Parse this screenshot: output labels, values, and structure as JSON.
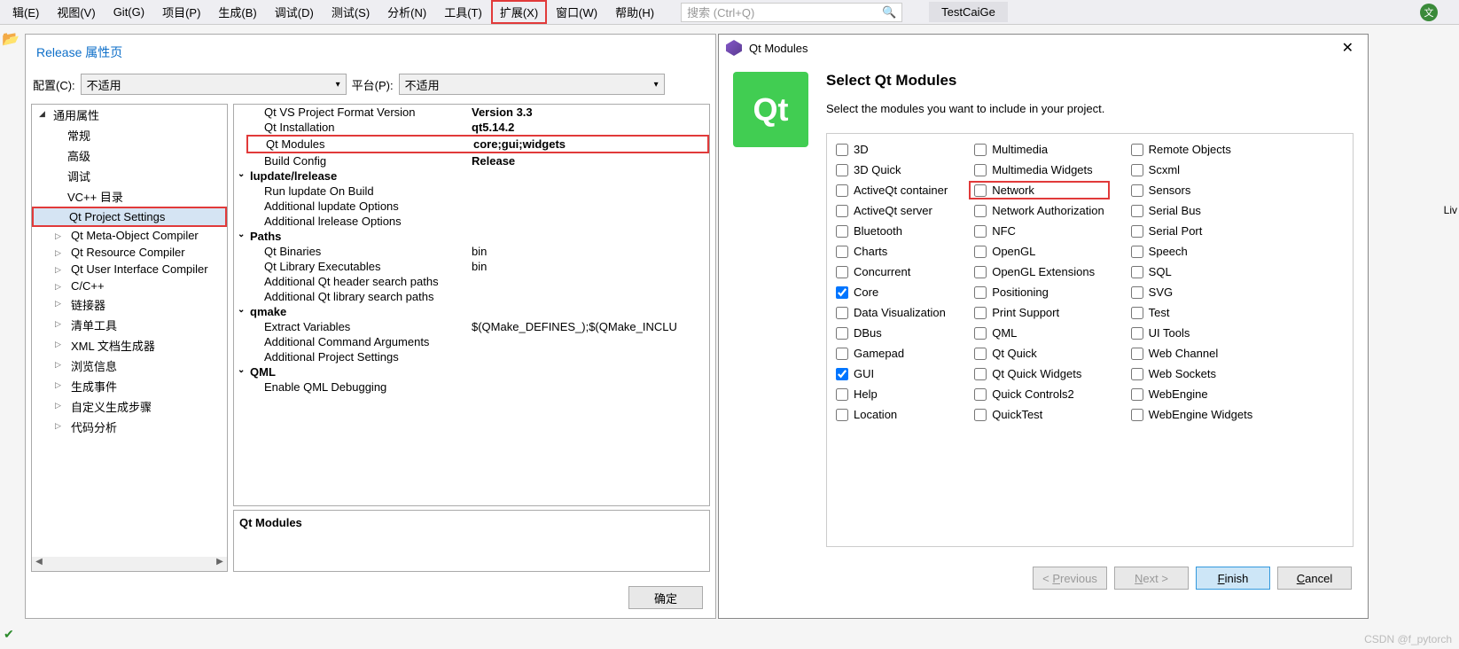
{
  "menubar": {
    "items": [
      "辑(E)",
      "视图(V)",
      "Git(G)",
      "项目(P)",
      "生成(B)",
      "调试(D)",
      "测试(S)",
      "分析(N)",
      "工具(T)",
      "扩展(X)",
      "窗口(W)",
      "帮助(H)"
    ],
    "highlighted_index": 9,
    "search_placeholder": "搜索 (Ctrl+Q)",
    "testcaige": "TestCaiGe",
    "user_initial": "文"
  },
  "prop_page": {
    "title": "Release 属性页",
    "config_label": "配置(C):",
    "config_value": "不适用",
    "platform_label": "平台(P):",
    "platform_value": "不适用",
    "tree": [
      {
        "label": "通用属性",
        "level": 1,
        "expanded": true
      },
      {
        "label": "常规",
        "level": 2
      },
      {
        "label": "高级",
        "level": 2
      },
      {
        "label": "调试",
        "level": 2
      },
      {
        "label": "VC++ 目录",
        "level": 2
      },
      {
        "label": "Qt Project Settings",
        "level": 2,
        "selected": true,
        "highlighted": true
      },
      {
        "label": "Qt Meta-Object Compiler",
        "level": 2,
        "expander": true
      },
      {
        "label": "Qt Resource Compiler",
        "level": 2,
        "expander": true
      },
      {
        "label": "Qt User Interface Compiler",
        "level": 2,
        "expander": true
      },
      {
        "label": "C/C++",
        "level": 2,
        "expander": true
      },
      {
        "label": "链接器",
        "level": 2,
        "expander": true
      },
      {
        "label": "清单工具",
        "level": 2,
        "expander": true
      },
      {
        "label": "XML 文档生成器",
        "level": 2,
        "expander": true
      },
      {
        "label": "浏览信息",
        "level": 2,
        "expander": true
      },
      {
        "label": "生成事件",
        "level": 2,
        "expander": true
      },
      {
        "label": "自定义生成步骤",
        "level": 2,
        "expander": true
      },
      {
        "label": "代码分析",
        "level": 2,
        "expander": true
      }
    ],
    "grid": [
      {
        "type": "row",
        "label": "Qt VS Project Format Version",
        "value": "Version 3.3",
        "bold": true
      },
      {
        "type": "row",
        "label": "Qt Installation",
        "value": "qt5.14.2",
        "bold": true
      },
      {
        "type": "row",
        "label": "Qt Modules",
        "value": "core;gui;widgets",
        "bold": true,
        "highlighted": true
      },
      {
        "type": "row",
        "label": "Build Config",
        "value": "Release",
        "bold": true
      },
      {
        "type": "header",
        "label": "lupdate/lrelease"
      },
      {
        "type": "row",
        "label": "Run lupdate On Build",
        "value": ""
      },
      {
        "type": "row",
        "label": "Additional lupdate Options",
        "value": ""
      },
      {
        "type": "row",
        "label": "Additional lrelease Options",
        "value": ""
      },
      {
        "type": "header",
        "label": "Paths"
      },
      {
        "type": "row",
        "label": "Qt Binaries",
        "value": "bin"
      },
      {
        "type": "row",
        "label": "Qt Library Executables",
        "value": "bin"
      },
      {
        "type": "row",
        "label": "Additional Qt header search paths",
        "value": ""
      },
      {
        "type": "row",
        "label": "Additional Qt library search paths",
        "value": ""
      },
      {
        "type": "header",
        "label": "qmake"
      },
      {
        "type": "row",
        "label": "Extract Variables",
        "value": "$(QMake_DEFINES_);$(QMake_INCLU"
      },
      {
        "type": "row",
        "label": "Additional Command Arguments",
        "value": ""
      },
      {
        "type": "row",
        "label": "Additional Project Settings",
        "value": ""
      },
      {
        "type": "header",
        "label": "QML"
      },
      {
        "type": "row",
        "label": "Enable QML Debugging",
        "value": ""
      }
    ],
    "desc_label": "Qt Modules",
    "ok_button": "确定"
  },
  "qt_dialog": {
    "title": "Qt Modules",
    "logo_text": "Qt",
    "heading": "Select Qt Modules",
    "subtext": "Select the modules you want to include in your project.",
    "col1": [
      {
        "label": "3D",
        "checked": false
      },
      {
        "label": "3D Quick",
        "checked": false
      },
      {
        "label": "ActiveQt container",
        "checked": false
      },
      {
        "label": "ActiveQt server",
        "checked": false
      },
      {
        "label": "Bluetooth",
        "checked": false
      },
      {
        "label": "Charts",
        "checked": false
      },
      {
        "label": "Concurrent",
        "checked": false
      },
      {
        "label": "Core",
        "checked": true
      },
      {
        "label": "Data Visualization",
        "checked": false
      },
      {
        "label": "DBus",
        "checked": false
      },
      {
        "label": "Gamepad",
        "checked": false
      },
      {
        "label": "GUI",
        "checked": true
      },
      {
        "label": "Help",
        "checked": false
      },
      {
        "label": "Location",
        "checked": false
      }
    ],
    "col2": [
      {
        "label": "Multimedia",
        "checked": false
      },
      {
        "label": "Multimedia Widgets",
        "checked": false
      },
      {
        "label": "Network",
        "checked": false,
        "highlighted": true
      },
      {
        "label": "Network Authorization",
        "checked": false
      },
      {
        "label": "NFC",
        "checked": false
      },
      {
        "label": "OpenGL",
        "checked": false
      },
      {
        "label": "OpenGL Extensions",
        "checked": false
      },
      {
        "label": "Positioning",
        "checked": false
      },
      {
        "label": "Print Support",
        "checked": false
      },
      {
        "label": "QML",
        "checked": false
      },
      {
        "label": "Qt Quick",
        "checked": false
      },
      {
        "label": "Qt Quick Widgets",
        "checked": false
      },
      {
        "label": "Quick Controls2",
        "checked": false
      },
      {
        "label": "QuickTest",
        "checked": false
      }
    ],
    "col3": [
      {
        "label": "Remote Objects",
        "checked": false
      },
      {
        "label": "Scxml",
        "checked": false
      },
      {
        "label": "Sensors",
        "checked": false
      },
      {
        "label": "Serial Bus",
        "checked": false
      },
      {
        "label": "Serial Port",
        "checked": false
      },
      {
        "label": "Speech",
        "checked": false
      },
      {
        "label": "SQL",
        "checked": false
      },
      {
        "label": "SVG",
        "checked": false
      },
      {
        "label": "Test",
        "checked": false
      },
      {
        "label": "UI Tools",
        "checked": false
      },
      {
        "label": "Web Channel",
        "checked": false
      },
      {
        "label": "Web Sockets",
        "checked": false
      },
      {
        "label": "WebEngine",
        "checked": false
      },
      {
        "label": "WebEngine Widgets",
        "checked": false
      }
    ],
    "buttons": {
      "previous": "Previous",
      "next": "Next >",
      "finish": "Finish",
      "cancel": "Cancel"
    }
  },
  "misc": {
    "watermark": "CSDN @f_pytorch",
    "right_text": "Liv"
  }
}
